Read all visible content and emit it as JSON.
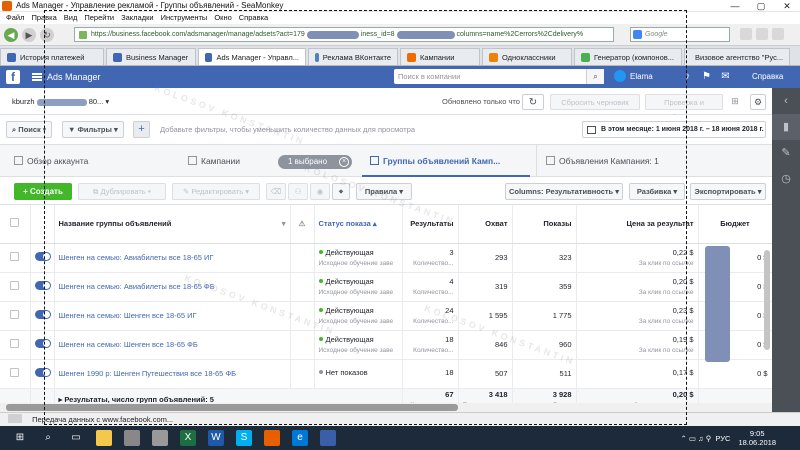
{
  "window": {
    "title": "Ads Manager - Управление рекламой - Группы объявлений - SeaMonkey",
    "controls": [
      "—",
      "▢",
      "✕"
    ]
  },
  "menu": [
    "Файл",
    "Правка",
    "Вид",
    "Перейти",
    "Закладки",
    "Инструменты",
    "Окно",
    "Справка"
  ],
  "nav": {
    "url_a": "https://business.facebook.com/adsmanager/manage/adsets?act=179",
    "url_b": "iness_id=8",
    "url_c": "columns=name%2Cerrors%2Cdelivery%",
    "search_placeholder": "Google"
  },
  "tabs": [
    {
      "label": "История платежей",
      "color": "#4267b2"
    },
    {
      "label": "Business Manager",
      "color": "#4267b2"
    },
    {
      "label": "Ads Manager - Управл...",
      "color": "#4267b2",
      "active": true
    },
    {
      "label": "Реклама ВКонтакте",
      "color": "#5181b8"
    },
    {
      "label": "Кампании",
      "color": "#ef6c00"
    },
    {
      "label": "Одноклассники",
      "color": "#ee8208"
    },
    {
      "label": "Генератор (компонов...",
      "color": "#4caf50"
    },
    {
      "label": "Визовое агентство \"Рус...",
      "color": "#c62828"
    }
  ],
  "fb": {
    "title": "Ads Manager",
    "search_placeholder": "Поиск в компании",
    "user": "Elama",
    "help": "Справка"
  },
  "account": {
    "name_prefix": "kburzh",
    "name_mid": "bsa2",
    "name_suffix": "80...",
    "updated": "Обновлено только что",
    "discard": "Сбросить черновик",
    "review": "Проверка и публикация"
  },
  "filters": {
    "search": "Поиск",
    "filters": "Фильтры",
    "hint": "Добавьте фильтры, чтобы уменьшить количество данных для просмотра",
    "date": "В этом месяце: 1 июня 2018 г. – 18 июня 2018 г."
  },
  "level_tabs": {
    "account": "Обзор аккаунта",
    "campaigns": "Кампании",
    "selected": "1 выбрано",
    "adsets": "Группы объявлений Камп...",
    "ads": "Объявления Кампания: 1"
  },
  "toolbar": {
    "create": "+ Создать",
    "duplicate": "Дублировать",
    "edit": "Редактировать",
    "rules": "Правила",
    "columns": "Columns: Результативность",
    "breakdown": "Разбивка",
    "export": "Экспортировать"
  },
  "table": {
    "headers": {
      "name": "Название группы объявлений",
      "status": "Статус показа",
      "results": "Результаты",
      "reach": "Охват",
      "impressions": "Показы",
      "cpr": "Цена за результат",
      "budget": "Бюджет"
    },
    "rows": [
      {
        "name": "Шенген на семью: Авиабилеты все 18-65 ИГ",
        "status": "Действующая",
        "status_sub": "Исходное обучение заве",
        "status_color": "#42b72a",
        "results": "3",
        "results_sub": "Количество...",
        "reach": "293",
        "impressions": "323",
        "cpr": "0,22 $",
        "cpr_sub": "За клик по ссылке"
      },
      {
        "name": "Шенген на семью: Авиабилеты все 18-65 ФБ",
        "status": "Действующая",
        "status_sub": "Исходное обучение заве",
        "status_color": "#42b72a",
        "results": "4",
        "results_sub": "Количество...",
        "reach": "319",
        "impressions": "359",
        "cpr": "0,20 $",
        "cpr_sub": "За клик по ссылке"
      },
      {
        "name": "Шенген на семью: Шенген все 18-65 ИГ",
        "status": "Действующая",
        "status_sub": "Исходное обучение заве",
        "status_color": "#42b72a",
        "results": "24",
        "results_sub": "Количество...",
        "reach": "1 595",
        "impressions": "1 775",
        "cpr": "0,23 $",
        "cpr_sub": "За клик по ссылке"
      },
      {
        "name": "Шенген на семью: Шенген все 18-65 ФБ",
        "status": "Действующая",
        "status_sub": "Исходное обучение заве",
        "status_color": "#42b72a",
        "results": "18",
        "results_sub": "Количество...",
        "reach": "846",
        "impressions": "960",
        "cpr": "0,19 $",
        "cpr_sub": "За клик по ссылке"
      },
      {
        "name": "Шенген 1990 р: Шенген Путешествия все 18-65 ФБ",
        "status": "Нет показов",
        "status_sub": "",
        "status_color": "#90949c",
        "results": "18",
        "results_sub": "",
        "reach": "507",
        "impressions": "511",
        "cpr": "0,17 $",
        "cpr_sub": ""
      }
    ],
    "total": {
      "label": "Результаты, число групп объявлений: 5",
      "results": "67",
      "results_sub": "Количество...",
      "reach": "3 418",
      "reach_sub": "Пользователи",
      "impressions": "3 928",
      "impressions_sub": "Всего",
      "cpr": "0,20 $",
      "cpr_sub": "За клик по ссылке"
    },
    "budget_visible": [
      "0 $",
      "0 $",
      "0 $",
      "0 $",
      "0 $"
    ]
  },
  "status_bar": "Передача данных с www.facebook.com...",
  "taskbar": {
    "lang": "РУС",
    "time": "9:05",
    "date": "18.06.2018"
  },
  "watermark": "KOLOSOV KONSTANTIN"
}
